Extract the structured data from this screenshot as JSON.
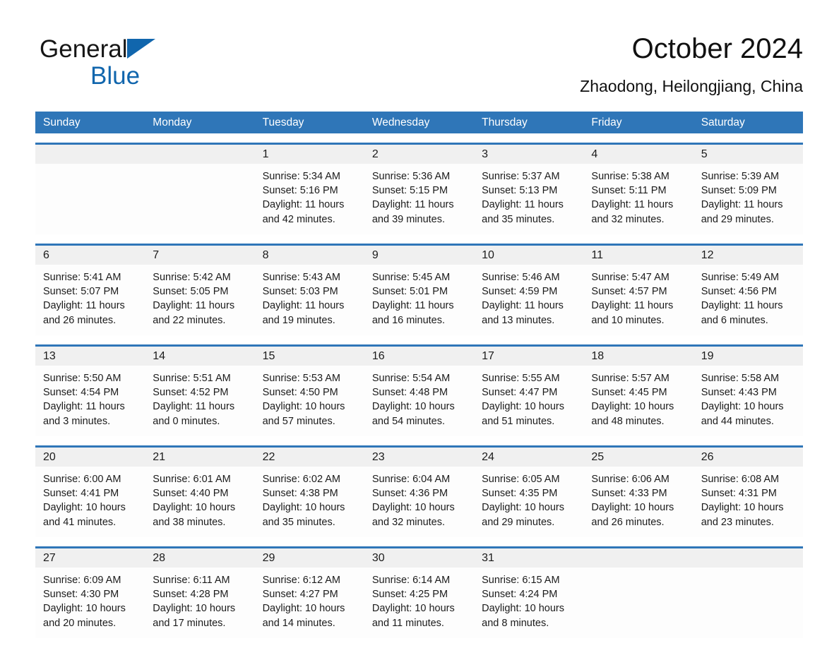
{
  "logo": {
    "word1": "General",
    "word2": "Blue",
    "triangle_color": "#1166ad",
    "text_color": "#161616"
  },
  "header": {
    "title": "October 2024",
    "subtitle": "Zhaodong, Heilongjiang, China"
  },
  "theme": {
    "header_blue": "#2f76b8",
    "daynum_band": "#f0f0f0",
    "cell_background": "#fdfdfd",
    "text": "#1b1b1b"
  },
  "weekdays": [
    "Sunday",
    "Monday",
    "Tuesday",
    "Wednesday",
    "Thursday",
    "Friday",
    "Saturday"
  ],
  "weeks": [
    [
      {
        "day": "",
        "sunrise": "",
        "sunset": "",
        "daylight1": "",
        "daylight2": ""
      },
      {
        "day": "",
        "sunrise": "",
        "sunset": "",
        "daylight1": "",
        "daylight2": ""
      },
      {
        "day": "1",
        "sunrise": "Sunrise: 5:34 AM",
        "sunset": "Sunset: 5:16 PM",
        "daylight1": "Daylight: 11 hours",
        "daylight2": "and 42 minutes."
      },
      {
        "day": "2",
        "sunrise": "Sunrise: 5:36 AM",
        "sunset": "Sunset: 5:15 PM",
        "daylight1": "Daylight: 11 hours",
        "daylight2": "and 39 minutes."
      },
      {
        "day": "3",
        "sunrise": "Sunrise: 5:37 AM",
        "sunset": "Sunset: 5:13 PM",
        "daylight1": "Daylight: 11 hours",
        "daylight2": "and 35 minutes."
      },
      {
        "day": "4",
        "sunrise": "Sunrise: 5:38 AM",
        "sunset": "Sunset: 5:11 PM",
        "daylight1": "Daylight: 11 hours",
        "daylight2": "and 32 minutes."
      },
      {
        "day": "5",
        "sunrise": "Sunrise: 5:39 AM",
        "sunset": "Sunset: 5:09 PM",
        "daylight1": "Daylight: 11 hours",
        "daylight2": "and 29 minutes."
      }
    ],
    [
      {
        "day": "6",
        "sunrise": "Sunrise: 5:41 AM",
        "sunset": "Sunset: 5:07 PM",
        "daylight1": "Daylight: 11 hours",
        "daylight2": "and 26 minutes."
      },
      {
        "day": "7",
        "sunrise": "Sunrise: 5:42 AM",
        "sunset": "Sunset: 5:05 PM",
        "daylight1": "Daylight: 11 hours",
        "daylight2": "and 22 minutes."
      },
      {
        "day": "8",
        "sunrise": "Sunrise: 5:43 AM",
        "sunset": "Sunset: 5:03 PM",
        "daylight1": "Daylight: 11 hours",
        "daylight2": "and 19 minutes."
      },
      {
        "day": "9",
        "sunrise": "Sunrise: 5:45 AM",
        "sunset": "Sunset: 5:01 PM",
        "daylight1": "Daylight: 11 hours",
        "daylight2": "and 16 minutes."
      },
      {
        "day": "10",
        "sunrise": "Sunrise: 5:46 AM",
        "sunset": "Sunset: 4:59 PM",
        "daylight1": "Daylight: 11 hours",
        "daylight2": "and 13 minutes."
      },
      {
        "day": "11",
        "sunrise": "Sunrise: 5:47 AM",
        "sunset": "Sunset: 4:57 PM",
        "daylight1": "Daylight: 11 hours",
        "daylight2": "and 10 minutes."
      },
      {
        "day": "12",
        "sunrise": "Sunrise: 5:49 AM",
        "sunset": "Sunset: 4:56 PM",
        "daylight1": "Daylight: 11 hours",
        "daylight2": "and 6 minutes."
      }
    ],
    [
      {
        "day": "13",
        "sunrise": "Sunrise: 5:50 AM",
        "sunset": "Sunset: 4:54 PM",
        "daylight1": "Daylight: 11 hours",
        "daylight2": "and 3 minutes."
      },
      {
        "day": "14",
        "sunrise": "Sunrise: 5:51 AM",
        "sunset": "Sunset: 4:52 PM",
        "daylight1": "Daylight: 11 hours",
        "daylight2": "and 0 minutes."
      },
      {
        "day": "15",
        "sunrise": "Sunrise: 5:53 AM",
        "sunset": "Sunset: 4:50 PM",
        "daylight1": "Daylight: 10 hours",
        "daylight2": "and 57 minutes."
      },
      {
        "day": "16",
        "sunrise": "Sunrise: 5:54 AM",
        "sunset": "Sunset: 4:48 PM",
        "daylight1": "Daylight: 10 hours",
        "daylight2": "and 54 minutes."
      },
      {
        "day": "17",
        "sunrise": "Sunrise: 5:55 AM",
        "sunset": "Sunset: 4:47 PM",
        "daylight1": "Daylight: 10 hours",
        "daylight2": "and 51 minutes."
      },
      {
        "day": "18",
        "sunrise": "Sunrise: 5:57 AM",
        "sunset": "Sunset: 4:45 PM",
        "daylight1": "Daylight: 10 hours",
        "daylight2": "and 48 minutes."
      },
      {
        "day": "19",
        "sunrise": "Sunrise: 5:58 AM",
        "sunset": "Sunset: 4:43 PM",
        "daylight1": "Daylight: 10 hours",
        "daylight2": "and 44 minutes."
      }
    ],
    [
      {
        "day": "20",
        "sunrise": "Sunrise: 6:00 AM",
        "sunset": "Sunset: 4:41 PM",
        "daylight1": "Daylight: 10 hours",
        "daylight2": "and 41 minutes."
      },
      {
        "day": "21",
        "sunrise": "Sunrise: 6:01 AM",
        "sunset": "Sunset: 4:40 PM",
        "daylight1": "Daylight: 10 hours",
        "daylight2": "and 38 minutes."
      },
      {
        "day": "22",
        "sunrise": "Sunrise: 6:02 AM",
        "sunset": "Sunset: 4:38 PM",
        "daylight1": "Daylight: 10 hours",
        "daylight2": "and 35 minutes."
      },
      {
        "day": "23",
        "sunrise": "Sunrise: 6:04 AM",
        "sunset": "Sunset: 4:36 PM",
        "daylight1": "Daylight: 10 hours",
        "daylight2": "and 32 minutes."
      },
      {
        "day": "24",
        "sunrise": "Sunrise: 6:05 AM",
        "sunset": "Sunset: 4:35 PM",
        "daylight1": "Daylight: 10 hours",
        "daylight2": "and 29 minutes."
      },
      {
        "day": "25",
        "sunrise": "Sunrise: 6:06 AM",
        "sunset": "Sunset: 4:33 PM",
        "daylight1": "Daylight: 10 hours",
        "daylight2": "and 26 minutes."
      },
      {
        "day": "26",
        "sunrise": "Sunrise: 6:08 AM",
        "sunset": "Sunset: 4:31 PM",
        "daylight1": "Daylight: 10 hours",
        "daylight2": "and 23 minutes."
      }
    ],
    [
      {
        "day": "27",
        "sunrise": "Sunrise: 6:09 AM",
        "sunset": "Sunset: 4:30 PM",
        "daylight1": "Daylight: 10 hours",
        "daylight2": "and 20 minutes."
      },
      {
        "day": "28",
        "sunrise": "Sunrise: 6:11 AM",
        "sunset": "Sunset: 4:28 PM",
        "daylight1": "Daylight: 10 hours",
        "daylight2": "and 17 minutes."
      },
      {
        "day": "29",
        "sunrise": "Sunrise: 6:12 AM",
        "sunset": "Sunset: 4:27 PM",
        "daylight1": "Daylight: 10 hours",
        "daylight2": "and 14 minutes."
      },
      {
        "day": "30",
        "sunrise": "Sunrise: 6:14 AM",
        "sunset": "Sunset: 4:25 PM",
        "daylight1": "Daylight: 10 hours",
        "daylight2": "and 11 minutes."
      },
      {
        "day": "31",
        "sunrise": "Sunrise: 6:15 AM",
        "sunset": "Sunset: 4:24 PM",
        "daylight1": "Daylight: 10 hours",
        "daylight2": "and 8 minutes."
      },
      {
        "day": "",
        "sunrise": "",
        "sunset": "",
        "daylight1": "",
        "daylight2": ""
      },
      {
        "day": "",
        "sunrise": "",
        "sunset": "",
        "daylight1": "",
        "daylight2": ""
      }
    ]
  ]
}
